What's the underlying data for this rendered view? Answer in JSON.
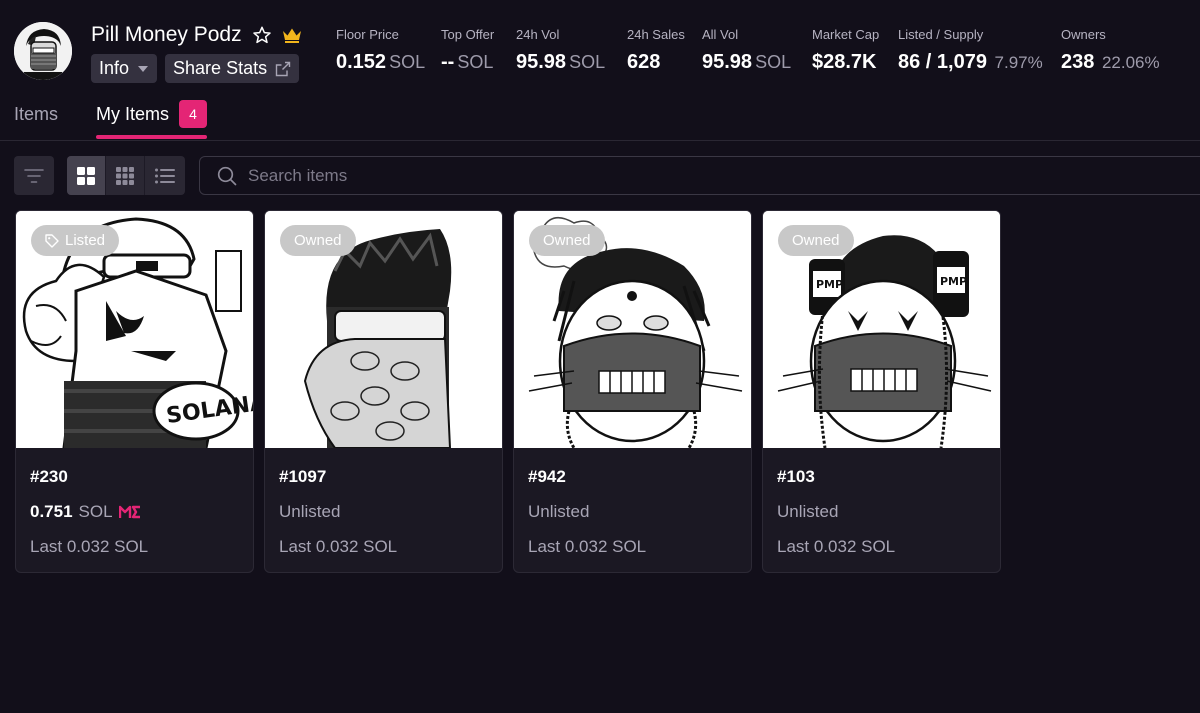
{
  "collection": {
    "name": "Pill Money Podz",
    "info_label": "Info",
    "share_label": "Share Stats"
  },
  "stats": [
    {
      "label": "Floor Price",
      "value": "0.152",
      "unit": "SOL",
      "pct": ""
    },
    {
      "label": "Top Offer",
      "value": "--",
      "unit": "SOL",
      "pct": ""
    },
    {
      "label": "24h Vol",
      "value": "95.98",
      "unit": "SOL",
      "pct": ""
    },
    {
      "label": "24h Sales",
      "value": "628",
      "unit": "",
      "pct": ""
    },
    {
      "label": "All Vol",
      "value": "95.98",
      "unit": "SOL",
      "pct": ""
    },
    {
      "label": "Market Cap",
      "value": "$28.7K",
      "unit": "",
      "pct": ""
    },
    {
      "label": "Listed / Supply",
      "value": "86 / 1,079",
      "unit": "",
      "pct": "7.97%"
    },
    {
      "label": "Owners",
      "value": "238",
      "unit": "",
      "pct": "22.06%"
    }
  ],
  "tabs": {
    "items_label": "Items",
    "my_items_label": "My Items",
    "my_items_count": "4"
  },
  "search": {
    "placeholder": "Search items"
  },
  "cards": [
    {
      "badge": "Listed",
      "name": "#230",
      "price": "0.751",
      "currency": "SOL",
      "marketplace_icon": "magic-eden-icon",
      "last": "Last 0.032 SOL",
      "art_text": "SOLANA"
    },
    {
      "badge": "Owned",
      "name": "#1097",
      "status": "Unlisted",
      "last": "Last 0.032 SOL"
    },
    {
      "badge": "Owned",
      "name": "#942",
      "status": "Unlisted",
      "last": "Last 0.032 SOL"
    },
    {
      "badge": "Owned",
      "name": "#103",
      "status": "Unlisted",
      "last": "Last 0.032 SOL",
      "art_text": "PMP"
    }
  ],
  "colors": {
    "background": "#120f1a",
    "accent": "#e42575",
    "card": "#1b1823",
    "crown": "#f2b51c"
  }
}
